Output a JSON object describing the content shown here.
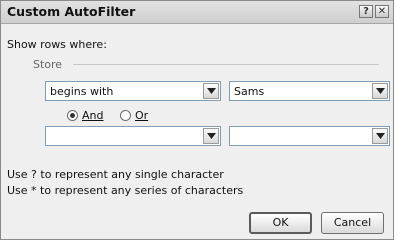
{
  "dialog": {
    "title": "Custom AutoFilter",
    "help_glyph": "?",
    "close_glyph": "✕"
  },
  "filter": {
    "show_rows_label": "Show rows where:",
    "field_name": "Store",
    "row1": {
      "operator": "begins with",
      "value": "Sams"
    },
    "logic": {
      "and_label": "And",
      "or_label": "Or",
      "selected": "And"
    },
    "row2": {
      "operator": "",
      "value": ""
    }
  },
  "hints": {
    "single_char": "Use ? to represent any single character",
    "series_chars": "Use * to represent any series of characters"
  },
  "buttons": {
    "ok": "OK",
    "cancel": "Cancel"
  }
}
